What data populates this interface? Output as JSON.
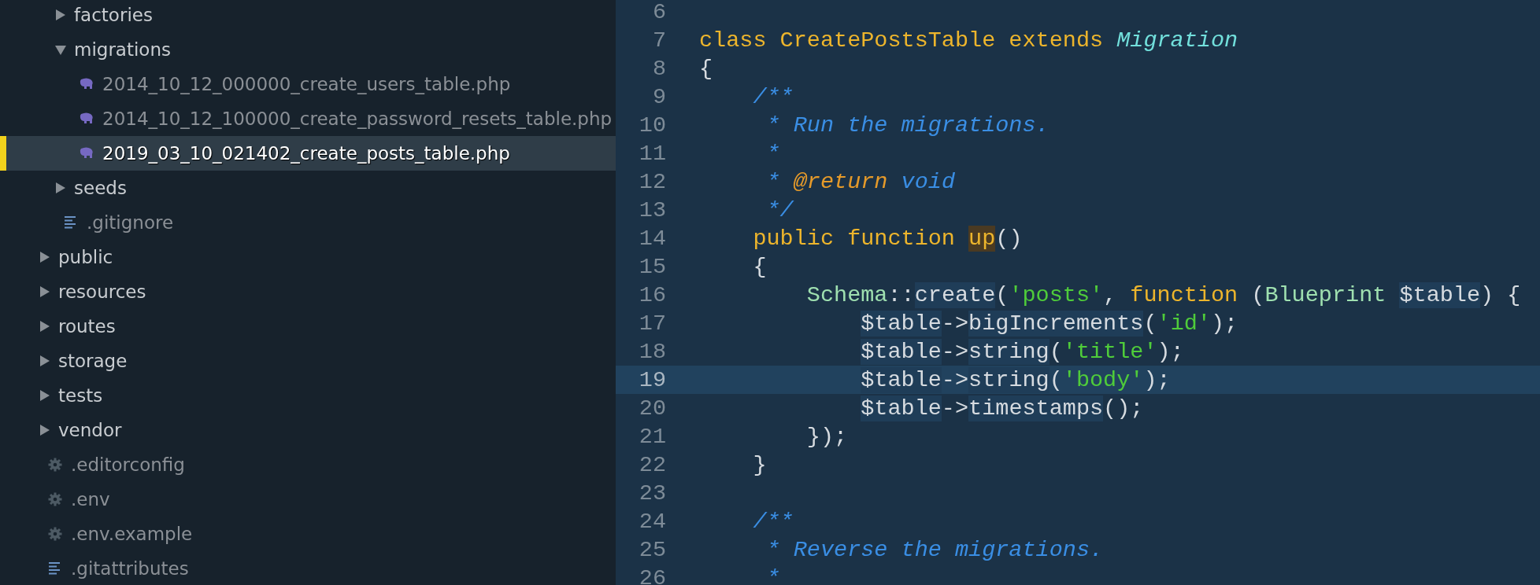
{
  "sidebar": {
    "items": [
      {
        "kind": "clipped_folder",
        "children": [
          {
            "kind": "folder",
            "name": "factories",
            "expanded": false,
            "selected": false
          },
          {
            "kind": "folder",
            "name": "migrations",
            "expanded": true,
            "selected": false,
            "children": [
              {
                "kind": "php_file",
                "name": "2014_10_12_000000_create_users_table.php",
                "selected": false
              },
              {
                "kind": "php_file",
                "name": "2014_10_12_100000_create_password_resets_table.php",
                "selected": false
              },
              {
                "kind": "php_file",
                "name": "2019_03_10_021402_create_posts_table.php",
                "selected": true
              }
            ]
          },
          {
            "kind": "folder",
            "name": "seeds",
            "expanded": false,
            "selected": false
          },
          {
            "kind": "text_file",
            "name": ".gitignore",
            "selected": false
          }
        ]
      },
      {
        "kind": "folder",
        "name": "public",
        "expanded": false,
        "selected": false
      },
      {
        "kind": "folder",
        "name": "resources",
        "expanded": false,
        "selected": false
      },
      {
        "kind": "folder",
        "name": "routes",
        "expanded": false,
        "selected": false
      },
      {
        "kind": "folder",
        "name": "storage",
        "expanded": false,
        "selected": false
      },
      {
        "kind": "folder",
        "name": "tests",
        "expanded": false,
        "selected": false
      },
      {
        "kind": "folder",
        "name": "vendor",
        "expanded": false,
        "selected": false
      },
      {
        "kind": "config_file",
        "name": ".editorconfig",
        "selected": false
      },
      {
        "kind": "config_file",
        "name": ".env",
        "selected": false
      },
      {
        "kind": "config_file",
        "name": ".env.example",
        "selected": false
      },
      {
        "kind": "text_file",
        "name": ".gitattributes",
        "selected": false
      }
    ]
  },
  "editor": {
    "lines": [
      {
        "number": "6",
        "current": false
      },
      {
        "number": "7",
        "current": false,
        "tokens": [
          {
            "text": "class CreatePostsTable extends ",
            "kind": "keyword"
          },
          {
            "text": "Migration",
            "kind": "type"
          }
        ]
      },
      {
        "number": "8",
        "current": false,
        "tokens": [
          {
            "text": "{",
            "kind": "plain"
          }
        ]
      },
      {
        "number": "9",
        "current": false,
        "tokens": [
          {
            "text": "    /**",
            "kind": "comment"
          }
        ]
      },
      {
        "number": "10",
        "current": false,
        "tokens": [
          {
            "text": "     * Run the migrations.",
            "kind": "comment"
          }
        ]
      },
      {
        "number": "11",
        "current": false,
        "tokens": [
          {
            "text": "     *",
            "kind": "comment"
          }
        ]
      },
      {
        "number": "12",
        "current": false,
        "tokens": [
          {
            "text": "     * ",
            "kind": "comment"
          },
          {
            "text": "@return",
            "kind": "tag"
          },
          {
            "text": " void",
            "kind": "comment"
          }
        ]
      },
      {
        "number": "13",
        "current": false,
        "tokens": [
          {
            "text": "     */",
            "kind": "comment"
          }
        ]
      },
      {
        "number": "14",
        "current": false,
        "tokens": [
          {
            "text": "    public function ",
            "kind": "keyword"
          },
          {
            "text": "up",
            "kind": "match"
          },
          {
            "text": "()",
            "kind": "plain"
          }
        ]
      },
      {
        "number": "15",
        "current": false,
        "tokens": [
          {
            "text": "    {",
            "kind": "plain"
          }
        ]
      },
      {
        "number": "16",
        "current": false,
        "tokens": [
          {
            "text": "        Schema",
            "kind": "class"
          },
          {
            "text": "::",
            "kind": "plain"
          },
          {
            "text": "create",
            "kind": "method"
          },
          {
            "text": "(",
            "kind": "plain"
          },
          {
            "text": "'posts'",
            "kind": "string"
          },
          {
            "text": ", ",
            "kind": "plain"
          },
          {
            "text": "function",
            "kind": "keyword"
          },
          {
            "text": " (",
            "kind": "plain"
          },
          {
            "text": "Blueprint",
            "kind": "class"
          },
          {
            "text": " $table",
            "kind": "variable"
          },
          {
            "text": ") {",
            "kind": "plain"
          }
        ]
      },
      {
        "number": "17",
        "current": false,
        "tokens": [
          {
            "text": "            $table",
            "kind": "variable"
          },
          {
            "text": "->",
            "kind": "plain"
          },
          {
            "text": "bigIncrements",
            "kind": "method"
          },
          {
            "text": "(",
            "kind": "plain"
          },
          {
            "text": "'id'",
            "kind": "string"
          },
          {
            "text": ");",
            "kind": "plain"
          }
        ]
      },
      {
        "number": "18",
        "current": false,
        "tokens": [
          {
            "text": "            $table",
            "kind": "variable"
          },
          {
            "text": "->",
            "kind": "plain"
          },
          {
            "text": "string",
            "kind": "method"
          },
          {
            "text": "(",
            "kind": "plain"
          },
          {
            "text": "'title'",
            "kind": "string"
          },
          {
            "text": ");",
            "kind": "plain"
          }
        ]
      },
      {
        "number": "19",
        "current": true,
        "tokens": [
          {
            "text": "            $table",
            "kind": "variable"
          },
          {
            "text": "->",
            "kind": "plain"
          },
          {
            "text": "string",
            "kind": "method"
          },
          {
            "text": "(",
            "kind": "plain"
          },
          {
            "text": "'body'",
            "kind": "string"
          },
          {
            "text": ");",
            "kind": "plain"
          }
        ]
      },
      {
        "number": "20",
        "current": false,
        "tokens": [
          {
            "text": "            $table",
            "kind": "variable"
          },
          {
            "text": "->",
            "kind": "plain"
          },
          {
            "text": "timestamps",
            "kind": "method"
          },
          {
            "text": "();",
            "kind": "plain"
          }
        ]
      },
      {
        "number": "21",
        "current": false,
        "tokens": [
          {
            "text": "        });",
            "kind": "plain"
          }
        ]
      },
      {
        "number": "22",
        "current": false,
        "tokens": [
          {
            "text": "    }",
            "kind": "plain"
          }
        ]
      },
      {
        "number": "23",
        "current": false
      },
      {
        "number": "24",
        "current": false,
        "tokens": [
          {
            "text": "    /**",
            "kind": "comment"
          }
        ]
      },
      {
        "number": "25",
        "current": false,
        "tokens": [
          {
            "text": "     * Reverse the migrations.",
            "kind": "comment"
          }
        ]
      },
      {
        "number": "26",
        "current": false,
        "tokens": [
          {
            "text": "     *",
            "kind": "comment"
          }
        ]
      }
    ]
  }
}
